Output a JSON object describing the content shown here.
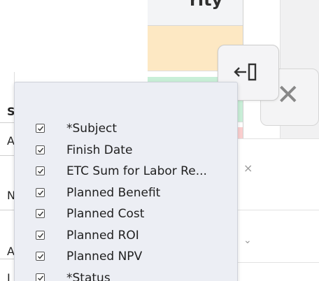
{
  "grid": {
    "header_text": "rity",
    "priority_colors": [
      "#fde8c3",
      "#c9efd8",
      "#fbcfcf"
    ],
    "left_strip": [
      "S",
      "A",
      "N",
      "A",
      "I"
    ]
  },
  "panel": {
    "collapse_icon": "collapse-panel-icon",
    "close_icon": "close-icon",
    "close_glyph": "✕",
    "row_close_glyph": "×",
    "row_chevron_glyph": "⌄"
  },
  "column_menu": {
    "items": [
      {
        "label": "*Subject",
        "checked": true
      },
      {
        "label": "Finish Date",
        "checked": true
      },
      {
        "label": "ETC Sum for Labor Re...",
        "checked": true
      },
      {
        "label": "Planned Benefit",
        "checked": true
      },
      {
        "label": "Planned Cost",
        "checked": true
      },
      {
        "label": "Planned ROI",
        "checked": true
      },
      {
        "label": "Planned NPV",
        "checked": true
      },
      {
        "label": "*Status",
        "checked": true
      }
    ]
  }
}
